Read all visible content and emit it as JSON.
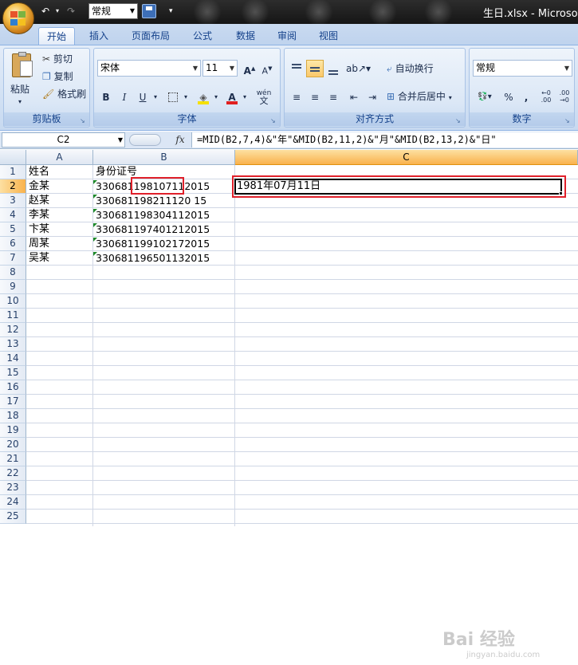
{
  "window": {
    "title": "生日.xlsx - Microsoft",
    "quick_access_style": "常规"
  },
  "tabs": [
    "开始",
    "插入",
    "页面布局",
    "公式",
    "数据",
    "审阅",
    "视图"
  ],
  "active_tab": "开始",
  "ribbon": {
    "clipboard": {
      "paste_label": "粘贴",
      "cut_label": "剪切",
      "copy_label": "复制",
      "format_painter_label": "格式刷",
      "group_label": "剪贴板"
    },
    "font": {
      "font_name": "宋体",
      "font_size": "11",
      "bold": "B",
      "italic": "I",
      "underline": "U",
      "phonetic": "wén",
      "phonetic_char": "文",
      "group_label": "字体"
    },
    "alignment": {
      "wrap_text_label": "自动换行",
      "merge_center_label": "合并后居中",
      "group_label": "对齐方式"
    },
    "number": {
      "format": "常规",
      "percent": "%",
      "comma": ",",
      "inc_decimal": ".00",
      "group_label": "数字"
    },
    "colors": {
      "font_color": "#e02020",
      "fill_color": "#f5e000"
    }
  },
  "formula_bar": {
    "name_box": "C2",
    "fx_label": "fx",
    "formula": "=MID(B2,7,4)&\"年\"&MID(B2,11,2)&\"月\"&MID(B2,13,2)&\"日\""
  },
  "sheet": {
    "columns": [
      "A",
      "B",
      "C"
    ],
    "selected_column": "C",
    "row_numbers": [
      "1",
      "2",
      "3",
      "4",
      "5",
      "6",
      "7",
      "8",
      "9",
      "10",
      "11",
      "12",
      "13",
      "14",
      "15",
      "16",
      "17",
      "18",
      "19",
      "20",
      "21",
      "22",
      "23",
      "24",
      "25"
    ],
    "selected_row": "2",
    "header_row": {
      "name": "姓名",
      "id": "身份证号"
    },
    "rows": [
      {
        "name": "金某",
        "id_prefix": "330681",
        "id_highlight": "19810711",
        "id_suffix": "2015"
      },
      {
        "name": "赵某",
        "id": "330681198211120 15"
      },
      {
        "name": "李某",
        "id": "330681198304112015"
      },
      {
        "name": "卞某",
        "id": "330681197401212015"
      },
      {
        "name": "周某",
        "id": "330681199102172015"
      },
      {
        "name": "吴某",
        "id": "330681196501132015"
      }
    ],
    "c2_value": "1981年07月11日"
  },
  "watermark": {
    "text": "Bai 经验",
    "sub": "jingyan.baidu.com"
  }
}
